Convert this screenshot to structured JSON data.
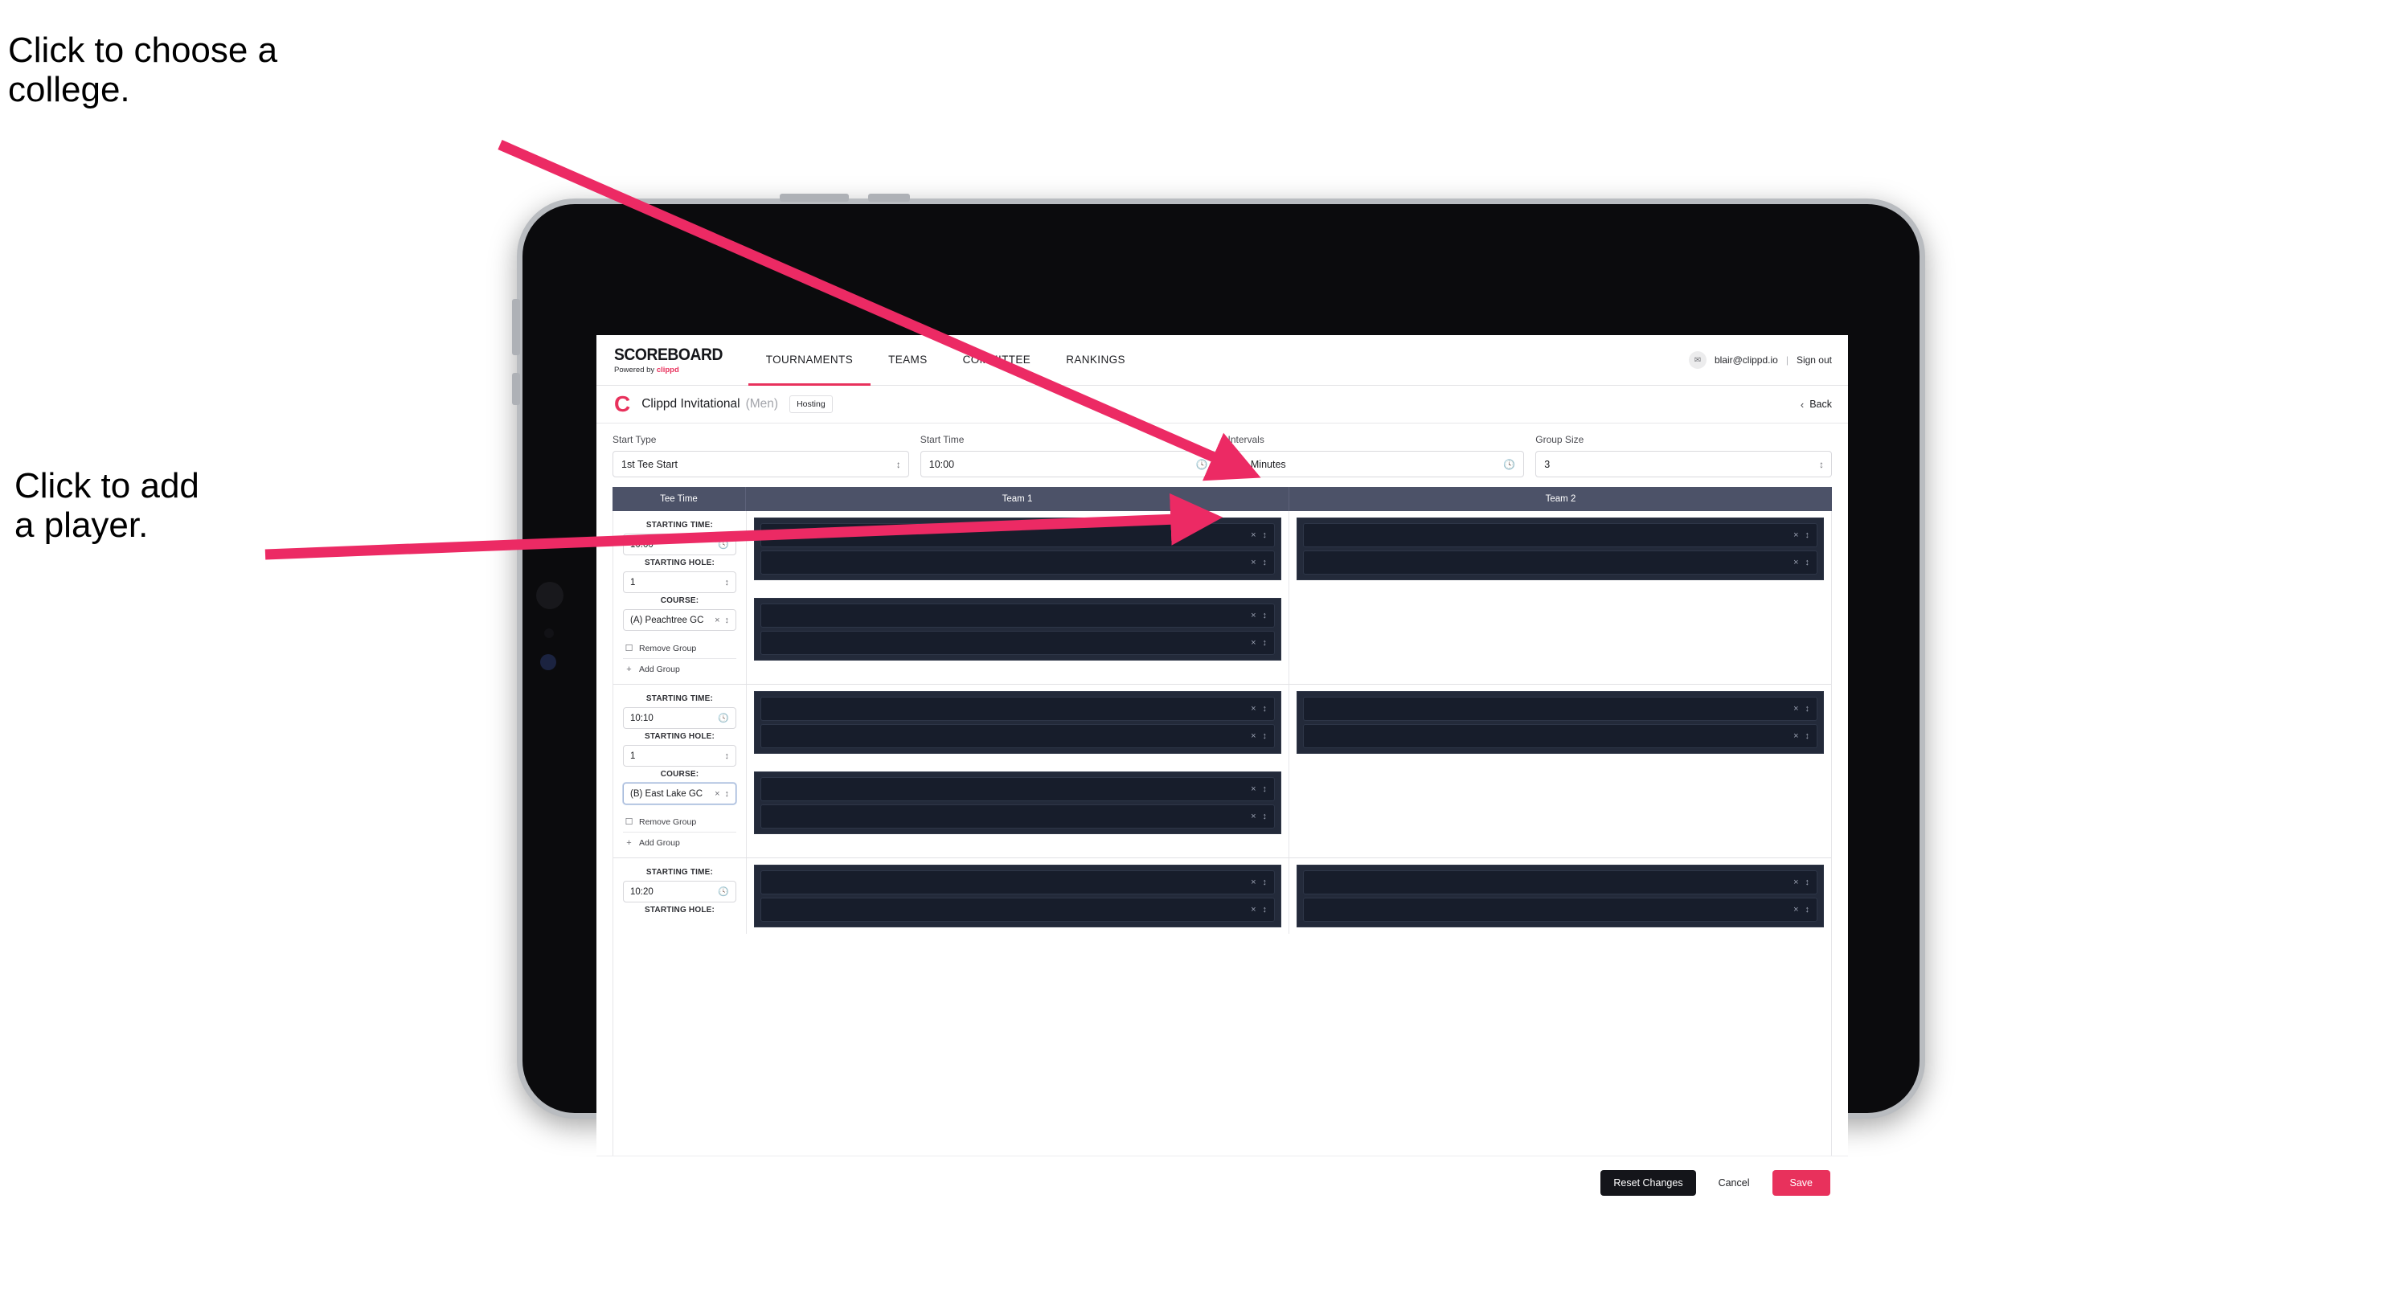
{
  "annotations": {
    "college": "Click to choose a\ncollege.",
    "player": "Click to add\na player."
  },
  "colors": {
    "accent_pink": "#e8315c",
    "table_header": "#4c5268",
    "player_block": "#232a3a",
    "player_slot": "#171d2b",
    "dark_button": "#14151a"
  },
  "nav": {
    "brand_wordmark": "SCOREBOARD",
    "brand_powered_prefix": "Powered by ",
    "brand_powered_name": "clippd",
    "tabs": [
      {
        "label": "TOURNAMENTS",
        "active": true
      },
      {
        "label": "TEAMS",
        "active": false
      },
      {
        "label": "COMMITTEE",
        "active": false
      },
      {
        "label": "RANKINGS",
        "active": false
      }
    ],
    "avatar_glyph": "✉",
    "user_email": "blair@clippd.io",
    "separator": "|",
    "sign_out": "Sign out"
  },
  "tournament_bar": {
    "logo_letter": "C",
    "name": "Clippd Invitational",
    "gender": "(Men)",
    "hosting_badge": "Hosting",
    "back_chevron": "‹",
    "back_label": "Back"
  },
  "settings": [
    {
      "label": "Start Type",
      "value": "1st Tee Start",
      "icon": "updown-icon",
      "icon_glyph": "⌃⌄",
      "name": "start-type"
    },
    {
      "label": "Start Time",
      "value": "10:00",
      "icon": "clock-icon",
      "icon_glyph": "◴",
      "name": "start-time"
    },
    {
      "label": "Intervals",
      "value": "10 Minutes",
      "icon": "clock-icon",
      "icon_glyph": "◴",
      "name": "intervals"
    },
    {
      "label": "Group Size",
      "value": "3",
      "icon": "updown-icon",
      "icon_glyph": "⌃⌄",
      "name": "group-size"
    }
  ],
  "table": {
    "columns": [
      "Tee Time",
      "Team 1",
      "Team 2"
    ],
    "labels": {
      "starting_time": "STARTING TIME:",
      "starting_hole": "STARTING HOLE:",
      "course": "COURSE:",
      "remove_group": "Remove Group",
      "add_group": "Add Group",
      "remove_icon_glyph": "☐",
      "add_icon_glyph": "+",
      "clear_glyph": "×",
      "chev_glyph": "⌃⌄"
    },
    "rows": [
      {
        "starting_time": "10:00",
        "starting_hole": "1",
        "course": "(A) Peachtree GC",
        "course_focused": false,
        "team1_blocks": [
          {
            "slots": [
              "",
              ""
            ]
          },
          {
            "slots": [
              "",
              ""
            ]
          }
        ],
        "team2_blocks": [
          {
            "slots": [
              "",
              ""
            ]
          }
        ]
      },
      {
        "starting_time": "10:10",
        "starting_hole": "1",
        "course": "(B) East Lake GC",
        "course_focused": true,
        "team1_blocks": [
          {
            "slots": [
              "",
              ""
            ]
          },
          {
            "slots": [
              "",
              ""
            ]
          }
        ],
        "team2_blocks": [
          {
            "slots": [
              "",
              ""
            ]
          }
        ]
      },
      {
        "starting_time": "10:20",
        "starting_hole": "",
        "course": "",
        "course_focused": false,
        "partial": true,
        "team1_blocks": [
          {
            "slots": [
              "",
              ""
            ]
          }
        ],
        "team2_blocks": [
          {
            "slots": [
              "",
              ""
            ]
          }
        ]
      }
    ]
  },
  "footer": {
    "reset_label": "Reset Changes",
    "cancel_label": "Cancel",
    "save_label": "Save"
  }
}
